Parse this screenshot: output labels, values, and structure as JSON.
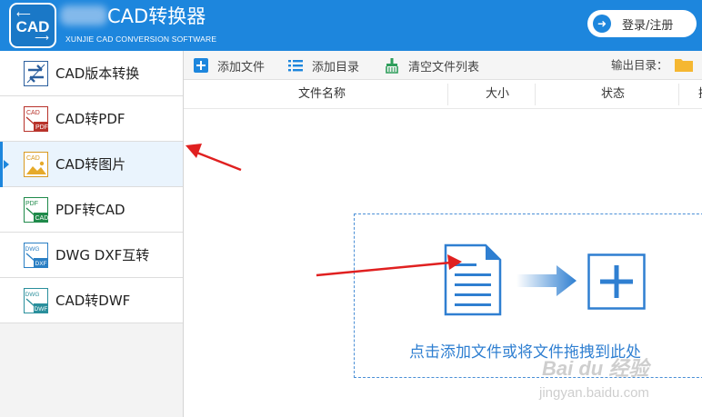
{
  "header": {
    "logo_text": "CAD",
    "title": "CAD转换器",
    "subtitle": "XUNJIE CAD CONVERSION SOFTWARE",
    "login_label": "登录/注册",
    "bg_color": "#1d86dd"
  },
  "sidebar": {
    "items": [
      {
        "label": "CAD版本转换",
        "icon": "cad-version-convert-icon"
      },
      {
        "label": "CAD转PDF",
        "icon": "cad-to-pdf-icon"
      },
      {
        "label": "CAD转图片",
        "icon": "cad-to-image-icon",
        "active": true
      },
      {
        "label": "PDF转CAD",
        "icon": "pdf-to-cad-icon"
      },
      {
        "label": "DWG DXF互转",
        "icon": "dwg-dxf-convert-icon"
      },
      {
        "label": "CAD转DWF",
        "icon": "cad-to-dwf-icon"
      }
    ]
  },
  "toolbar": {
    "add_file": "添加文件",
    "add_folder": "添加目录",
    "clear_list": "清空文件列表",
    "output_dir_label": "输出目录："
  },
  "table": {
    "columns": [
      "文件名称",
      "大小",
      "状态",
      "操"
    ]
  },
  "dropzone": {
    "hint": "点击添加文件或将文件拖拽到此处",
    "accent": "#2f7fd1"
  },
  "watermark": {
    "main": "Bai du 经验",
    "sub": "jingyan.baidu.com"
  }
}
